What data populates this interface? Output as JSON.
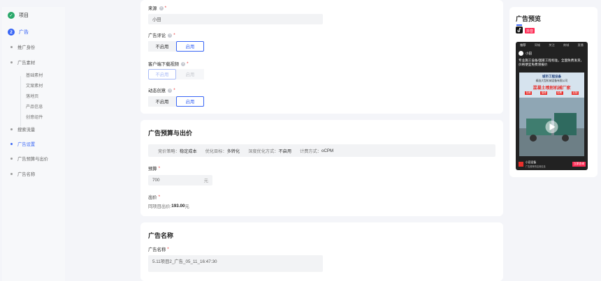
{
  "steps": {
    "done": {
      "label": "项目"
    },
    "active": {
      "number": "2",
      "label": "广告"
    },
    "items": [
      {
        "label": "推广身份"
      },
      {
        "label": "广告素材"
      },
      {
        "label": "搜索流量"
      },
      {
        "label": "广告设置"
      },
      {
        "label": "广告预算与出价"
      },
      {
        "label": "广告名称"
      }
    ],
    "sub_items": [
      "基础素材",
      "文案素材",
      "落地页",
      "产品信息",
      "创意组件"
    ],
    "active_sub": "广告设置"
  },
  "settings": {
    "source": {
      "label": "来源",
      "value": "小田"
    },
    "comment": {
      "label": "广告评论",
      "options": [
        "不启用",
        "启用"
      ],
      "selected": "启用"
    },
    "download": {
      "label": "客户端下载视频",
      "options": [
        "不启用",
        "启用"
      ],
      "selected": "不启用"
    },
    "dynamic": {
      "label": "动态创意",
      "options": [
        "不启用",
        "启用"
      ],
      "selected": "启用"
    }
  },
  "budget": {
    "title": "广告预算与出价",
    "strategy": [
      {
        "label": "竞价策略：",
        "value": "稳定成本"
      },
      {
        "label": "优化目标：",
        "value": "多转化"
      },
      {
        "label": "深度优化方式：",
        "value": "不启用"
      },
      {
        "label": "计费方式：",
        "value": "oCPM"
      }
    ],
    "budget_label": "预算",
    "budget_value": "700",
    "budget_unit": "元",
    "bid_label": "出价",
    "bid_text_prefix": "同项目出价: ",
    "bid_value": "193.00",
    "bid_unit": " 元"
  },
  "name_section": {
    "title": "广告名称",
    "label": "广告名称",
    "value": "5.11项目2_广告_05_11_16:47:30"
  },
  "preview": {
    "title": "广告预览",
    "badge": "抖音",
    "tabs": [
      "推荐",
      "同城",
      "关注",
      "商城",
      "直播"
    ],
    "account": "小田",
    "headline": "专业施工设备/国家工程标准，全国免费发货，价格便宜免费领报价",
    "poster_top": "城市工程设备",
    "poster_sub": "精选大型机械设备有限公司",
    "poster_main": "混凝土喷射机械厂家",
    "poster_tags": [
      "包邮",
      "保修",
      "包教",
      "定制"
    ],
    "bottom_name": "小田设备",
    "bottom_desc": "广告推荐的应用信息",
    "bottom_btn": "立即咨询",
    "colors": {
      "accent": "#3865f5",
      "tiktok_badge": "#fe2c55",
      "poster_main": "#e8302c"
    }
  }
}
